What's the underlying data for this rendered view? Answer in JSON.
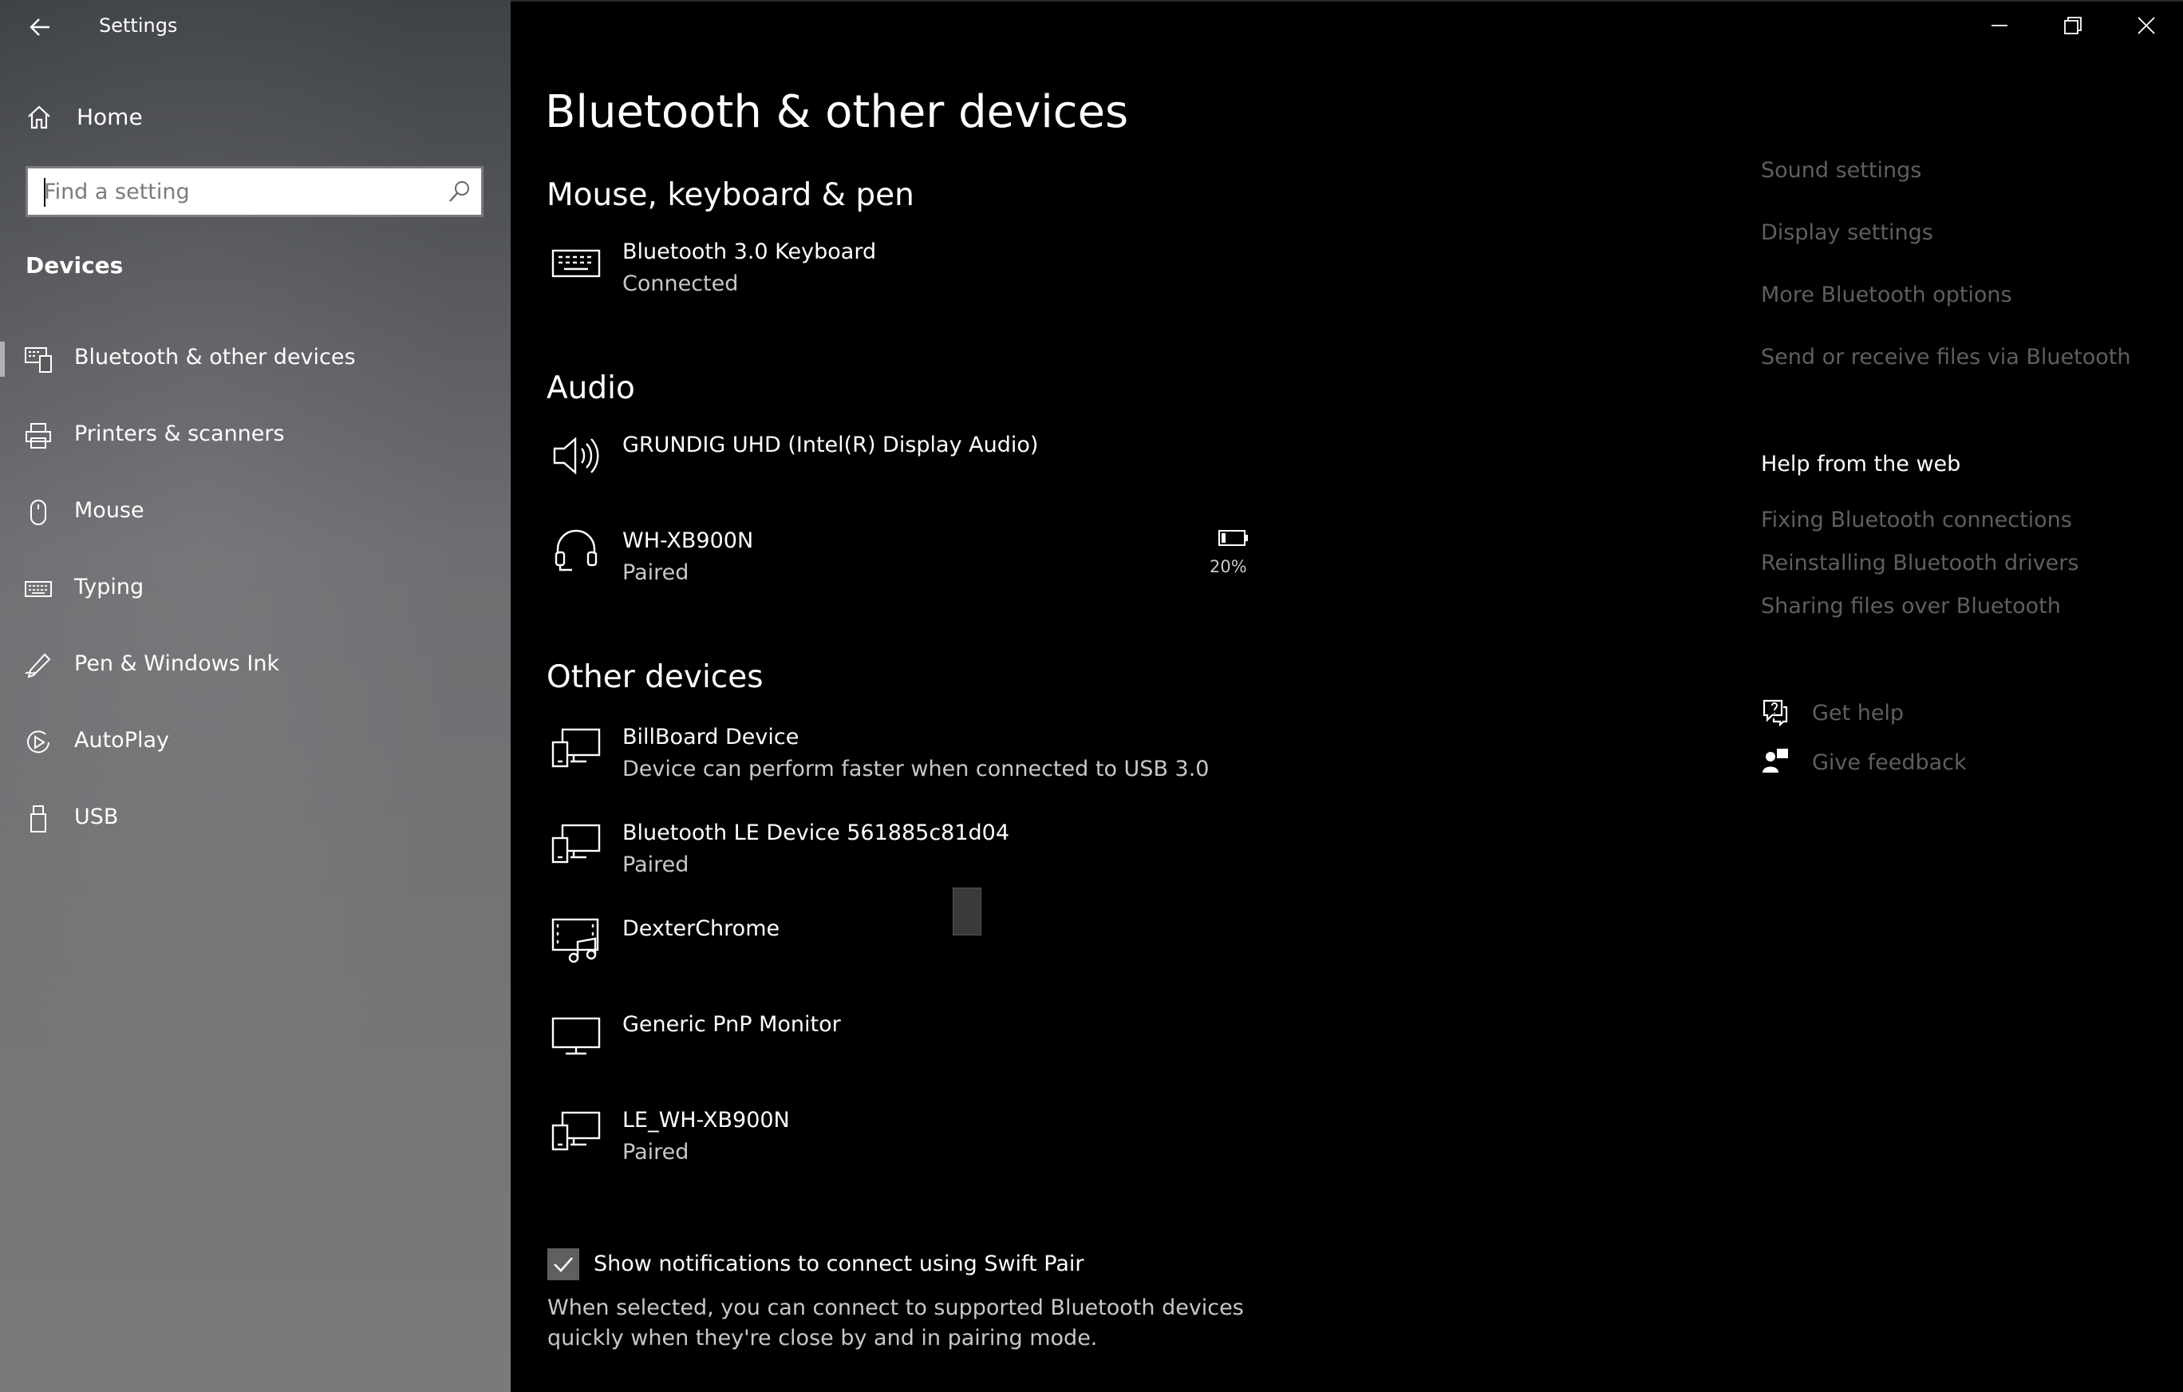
{
  "window": {
    "app_title": "Settings",
    "controls": [
      "minimize",
      "restore",
      "close"
    ]
  },
  "sidebar": {
    "home_label": "Home",
    "search": {
      "placeholder": "Find a setting",
      "value": ""
    },
    "section_label": "Devices",
    "items": [
      {
        "label": "Bluetooth & other devices",
        "icon": "bluetooth-devices-icon",
        "active": true
      },
      {
        "label": "Printers & scanners",
        "icon": "printer-icon",
        "active": false
      },
      {
        "label": "Mouse",
        "icon": "mouse-icon",
        "active": false
      },
      {
        "label": "Typing",
        "icon": "keyboard-icon",
        "active": false
      },
      {
        "label": "Pen & Windows Ink",
        "icon": "pen-icon",
        "active": false
      },
      {
        "label": "AutoPlay",
        "icon": "autoplay-icon",
        "active": false
      },
      {
        "label": "USB",
        "icon": "usb-icon",
        "active": false
      }
    ]
  },
  "main": {
    "page_title": "Bluetooth & other devices",
    "groups": {
      "mouse_keyboard": {
        "heading": "Mouse, keyboard & pen",
        "devices": [
          {
            "name": "Bluetooth 3.0 Keyboard",
            "status": "Connected",
            "icon": "keyboard-icon"
          }
        ]
      },
      "audio": {
        "heading": "Audio",
        "devices": [
          {
            "name": "GRUNDIG UHD (Intel(R) Display Audio)",
            "status": "",
            "icon": "speaker-icon"
          },
          {
            "name": "WH-XB900N",
            "status": "Paired",
            "icon": "headset-icon",
            "battery": "20%"
          }
        ]
      },
      "other": {
        "heading": "Other devices",
        "devices": [
          {
            "name": "BillBoard Device",
            "status": "Device can perform faster when connected to USB 3.0",
            "icon": "generic-device-icon"
          },
          {
            "name": "Bluetooth LE Device 561885c81d04",
            "status": "Paired",
            "icon": "generic-device-icon"
          },
          {
            "name": "DexterChrome",
            "status": "",
            "icon": "media-device-icon"
          },
          {
            "name": "Generic PnP Monitor",
            "status": "",
            "icon": "monitor-icon"
          },
          {
            "name": "LE_WH-XB900N",
            "status": "Paired",
            "icon": "generic-device-icon"
          }
        ]
      }
    },
    "swift_pair": {
      "label": "Show notifications to connect using Swift Pair",
      "checked": true,
      "description": "When selected, you can connect to supported Bluetooth devices quickly when they're close by and in pairing mode."
    }
  },
  "related": {
    "links": [
      "Sound settings",
      "Display settings",
      "More Bluetooth options",
      "Send or receive files via Bluetooth"
    ],
    "help_heading": "Help from the web",
    "help_links": [
      "Fixing Bluetooth connections",
      "Reinstalling Bluetooth drivers",
      "Sharing files over Bluetooth"
    ],
    "get_help": "Get help",
    "give_feedback": "Give feedback"
  },
  "colors": {
    "background": "#000000",
    "text": "#ffffff",
    "secondary_text": "#c8c8c8",
    "disabled_link": "#5f5f5f"
  }
}
